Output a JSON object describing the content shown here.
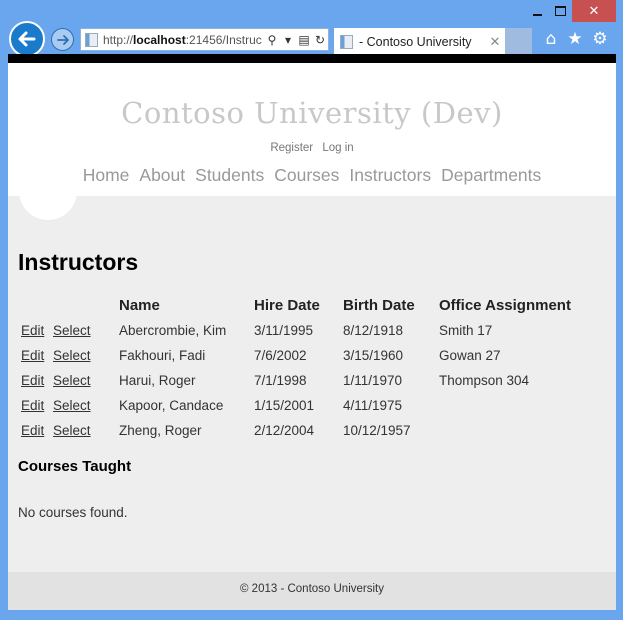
{
  "browser": {
    "address_url_prefix": "http://",
    "address_url_host": "localhost",
    "address_url_rest": ":21456/Instruc",
    "tab_title": "- Contoso University",
    "icons": {
      "back": "arrow-left-icon",
      "forward": "arrow-right-icon",
      "search": "search-icon",
      "dropdown": "chevron-down-icon",
      "compat": "compatibility-view-icon",
      "refresh": "refresh-icon",
      "tab_close": "close-icon",
      "home": "home-icon",
      "favorites": "star-icon",
      "tools": "gear-icon"
    },
    "glyphs": {
      "search": "⚲",
      "dropdown": "▾",
      "compat": "▤",
      "refresh": "↻",
      "tab_close": "✕",
      "close": "✕",
      "home": "⌂",
      "star": "★",
      "gear": "⚙"
    }
  },
  "site": {
    "title": "Contoso University (Dev)",
    "login_links": [
      "Register",
      "Log in"
    ],
    "menu": [
      "Home",
      "About",
      "Students",
      "Courses",
      "Instructors",
      "Departments"
    ]
  },
  "page": {
    "heading": "Instructors",
    "table": {
      "headers": [
        "",
        "",
        "Name",
        "Hire Date",
        "Birth Date",
        "Office Assignment"
      ],
      "rows": [
        {
          "edit": "Edit",
          "select": "Select",
          "name": "Abercrombie, Kim",
          "hire": "3/11/1995",
          "birth": "8/12/1918",
          "office": "Smith 17"
        },
        {
          "edit": "Edit",
          "select": "Select",
          "name": "Fakhouri, Fadi",
          "hire": "7/6/2002",
          "birth": "3/15/1960",
          "office": "Gowan 27"
        },
        {
          "edit": "Edit",
          "select": "Select",
          "name": "Harui, Roger",
          "hire": "7/1/1998",
          "birth": "1/11/1970",
          "office": "Thompson 304"
        },
        {
          "edit": "Edit",
          "select": "Select",
          "name": "Kapoor, Candace",
          "hire": "1/15/2001",
          "birth": "4/11/1975",
          "office": ""
        },
        {
          "edit": "Edit",
          "select": "Select",
          "name": "Zheng, Roger",
          "hire": "2/12/2004",
          "birth": "10/12/1957",
          "office": ""
        }
      ]
    },
    "courses_heading": "Courses Taught",
    "no_courses": "No courses found."
  },
  "footer": {
    "text": "© 2013 - Contoso University"
  },
  "colors": {
    "chrome": "#6aa6ee",
    "back_button": "#1a7acb",
    "close_button": "#c75050",
    "content_bg": "#eeeeee",
    "footer_bg": "#e2e2e2",
    "title_gray": "#c8c8c8"
  }
}
